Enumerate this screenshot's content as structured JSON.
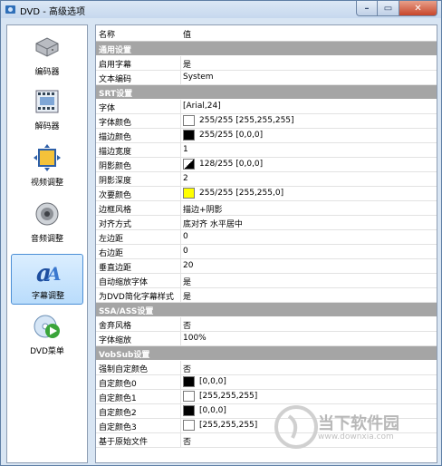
{
  "window": {
    "title": "DVD - 高级选项"
  },
  "sidebar": {
    "items": [
      {
        "label": "编码器",
        "icon": "hard-drive-icon"
      },
      {
        "label": "解码器",
        "icon": "film-reel-icon"
      },
      {
        "label": "视频调整",
        "icon": "video-frame-icon"
      },
      {
        "label": "音频调整",
        "icon": "speaker-icon"
      },
      {
        "label": "字幕调整",
        "icon": "subtitle-letter-icon",
        "selected": true
      },
      {
        "label": "DVD菜单",
        "icon": "dvd-play-icon"
      }
    ]
  },
  "grid": {
    "headers": {
      "name": "名称",
      "value": "值"
    },
    "sections": [
      {
        "title": "通用设置",
        "rows": [
          {
            "name": "启用字幕",
            "value": "是"
          },
          {
            "name": "文本编码",
            "value": "System"
          }
        ]
      },
      {
        "title": "SRT设置",
        "rows": [
          {
            "name": "字体",
            "value": "[Arial,24]"
          },
          {
            "name": "字体颜色",
            "value": "255/255 [255,255,255]",
            "swatch": "#ffffff"
          },
          {
            "name": "描边颜色",
            "value": "255/255 [0,0,0]",
            "swatch": "#000000"
          },
          {
            "name": "描边宽度",
            "value": "1"
          },
          {
            "name": "阴影颜色",
            "value": "128/255 [0,0,0]",
            "swatch": "half"
          },
          {
            "name": "阴影深度",
            "value": "2"
          },
          {
            "name": "次要颜色",
            "value": "255/255 [255,255,0]",
            "swatch": "#ffff00"
          },
          {
            "name": "边框风格",
            "value": "描边+阴影"
          },
          {
            "name": "对齐方式",
            "value": "底对齐 水平居中"
          },
          {
            "name": "左边距",
            "value": "0"
          },
          {
            "name": "右边距",
            "value": "0"
          },
          {
            "name": "垂直边距",
            "value": "20"
          },
          {
            "name": "自动缩放字体",
            "value": "是"
          },
          {
            "name": "为DVD简化字幕样式",
            "value": "是"
          }
        ]
      },
      {
        "title": "SSA/ASS设置",
        "rows": [
          {
            "name": "舍弃风格",
            "value": "否"
          },
          {
            "name": "字体缩放",
            "value": "100%"
          }
        ]
      },
      {
        "title": "VobSub设置",
        "rows": [
          {
            "name": "强制自定颜色",
            "value": "否"
          },
          {
            "name": "自定颜色0",
            "value": "[0,0,0]",
            "swatch": "#000000"
          },
          {
            "name": "自定颜色1",
            "value": "[255,255,255]",
            "swatch": "#ffffff"
          },
          {
            "name": "自定颜色2",
            "value": "[0,0,0]",
            "swatch": "#000000"
          },
          {
            "name": "自定颜色3",
            "value": "[255,255,255]",
            "swatch": "#ffffff"
          },
          {
            "name": "基于原始文件",
            "value": "否"
          }
        ]
      }
    ]
  },
  "watermark": {
    "text": "当下软件园",
    "url": "www.downxia.com"
  }
}
